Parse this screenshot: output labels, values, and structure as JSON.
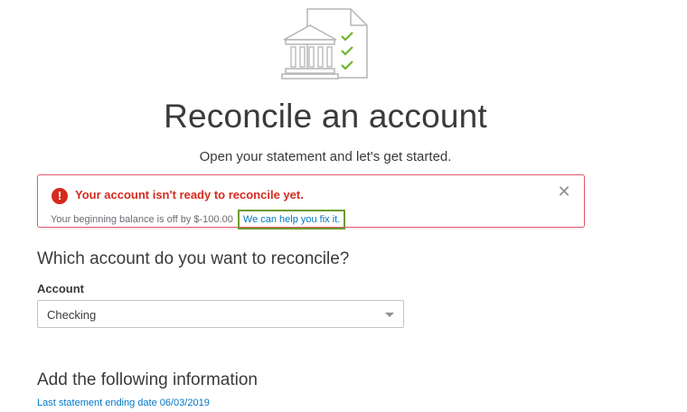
{
  "header": {
    "illustration_icon": "bank-statement-checklist-icon",
    "title": "Reconcile an account",
    "subtitle": "Open your statement and let's get started."
  },
  "alert": {
    "icon": "error-icon",
    "title": "Your account isn't ready to reconcile yet.",
    "message": "Your beginning balance is off by $-100.00",
    "link_text": "We can help you fix it.",
    "close_icon": "close-icon",
    "accent_color": "#d52b1e"
  },
  "account_section": {
    "heading": "Which account do you want to reconcile?",
    "field_label": "Account",
    "selected_value": "Checking",
    "caret_icon": "chevron-down-icon"
  },
  "info_section": {
    "heading": "Add the following information",
    "statement_link": "Last statement ending date 06/03/2019"
  },
  "colors": {
    "link": "#0077c5",
    "check_green": "#6cb52d",
    "highlight_border": "#6b9b2f"
  }
}
